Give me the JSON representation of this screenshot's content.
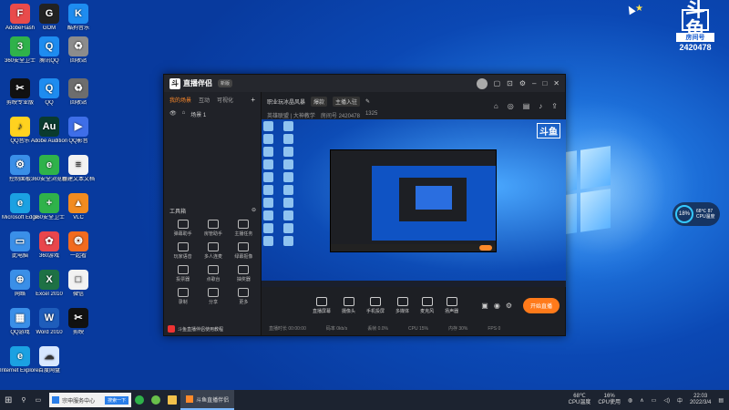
{
  "desktop": {
    "icons": [
      {
        "label": "AdobeFlash",
        "color": "#e94b4b",
        "glyph": "F"
      },
      {
        "label": "GOM",
        "color": "#222",
        "glyph": "G"
      },
      {
        "label": "酷狗音乐",
        "color": "#1e8cf0",
        "glyph": "K"
      },
      {
        "label": "360安全卫士",
        "color": "#2fb24a",
        "glyph": "3"
      },
      {
        "label": "腾讯QQ",
        "color": "#1e8cf0",
        "glyph": "Q"
      },
      {
        "label": "回收站",
        "color": "#8c8c8c",
        "glyph": "♻"
      },
      {
        "label": "剪映专业版",
        "color": "#111",
        "glyph": "✂"
      },
      {
        "label": "QQ",
        "color": "#1e8cf0",
        "glyph": "Q"
      },
      {
        "label": "回收站",
        "color": "#6d6d6d",
        "glyph": "♻"
      },
      {
        "label": "QQ音乐",
        "color": "#ffd21f",
        "glyph": "♪"
      },
      {
        "label": "Adobe Audition",
        "color": "#0a3b2e",
        "glyph": "Au"
      },
      {
        "label": "QQ影音",
        "color": "#3e6ee8",
        "glyph": "▶"
      },
      {
        "label": "控制面板",
        "color": "#3a8fe8",
        "glyph": "⚙"
      },
      {
        "label": "360安全浏览器",
        "color": "#2fb24a",
        "glyph": "e"
      },
      {
        "label": "新建文本文档",
        "color": "#f2f2f2",
        "glyph": "≡"
      },
      {
        "label": "Microsoft Edge",
        "color": "#1ba1e2",
        "glyph": "e"
      },
      {
        "label": "360安全卫士",
        "color": "#2fb24a",
        "glyph": "+"
      },
      {
        "label": "VLC",
        "color": "#f28b1f",
        "glyph": "▲"
      },
      {
        "label": "此电脑",
        "color": "#3a8fe8",
        "glyph": "▭"
      },
      {
        "label": "360游戏",
        "color": "#e9464c",
        "glyph": "✿"
      },
      {
        "label": "一起看",
        "color": "#f26b1f",
        "glyph": "❂"
      },
      {
        "label": "网络",
        "color": "#3a8fe8",
        "glyph": "⊕"
      },
      {
        "label": "Excel 2010",
        "color": "#1e7145",
        "glyph": "X"
      },
      {
        "label": "微信",
        "color": "#f2f2f2",
        "glyph": "□"
      },
      {
        "label": "QQ游戏",
        "color": "#3a8fe8",
        "glyph": "▦"
      },
      {
        "label": "Word 2010",
        "color": "#1e5dbb",
        "glyph": "W"
      },
      {
        "label": "剪映",
        "color": "#111",
        "glyph": "✂"
      },
      {
        "label": "Internet Explorer",
        "color": "#1ba1e2",
        "glyph": "e"
      },
      {
        "label": "百度网盘",
        "color": "#d8e8ff",
        "glyph": "☁"
      }
    ],
    "brand": {
      "logo": "斗鱼",
      "caption": "房间号",
      "room": "2420478"
    },
    "perf": {
      "percent": "18%",
      "temp": "68℃ 87",
      "label": "CPU温度"
    }
  },
  "app": {
    "title": "直播伴侣",
    "version": "新版",
    "left_tabs": [
      "我的场景",
      "互动",
      "可视化"
    ],
    "scene_label": "场景 1",
    "tools_header": "工具箱",
    "tools": [
      "弹幕助手",
      "房管助手",
      "主播任务",
      "玩家语音",
      "多人连麦",
      "绿幕抠像",
      "投票器",
      "点歌台",
      "抽奖器",
      "录制",
      "分享",
      "更多"
    ],
    "notice": "斗鱼直播伴侣使用教程",
    "room_title": "职业玩冰晶风暴",
    "room_tag": "爆款",
    "room_sub": "主播入驻",
    "category": "英雄联盟 | 大神教学",
    "room_info": "房间号 2420478",
    "followers": "1325",
    "controls": [
      "直播屏幕",
      "摄像头",
      "手机投屏",
      "多媒体",
      "麦克风",
      "扬声器"
    ],
    "live_btn": "开始直播",
    "status_items": [
      "直播时长 00:00:00",
      "码率 0kb/s",
      "丢帧 0.0%",
      "CPU 15%",
      "内存 30%",
      "FPS 0"
    ]
  },
  "taskbar": {
    "search_text": "宗申服务中心",
    "search_btn": "搜索一下",
    "active_app": "斗鱼直播伴侣",
    "temp": "68℃",
    "temp_label": "CPU温度",
    "cpu": "16%",
    "cpu_label": "CPU使用",
    "time": "22:03",
    "date": "2022/3/4"
  }
}
